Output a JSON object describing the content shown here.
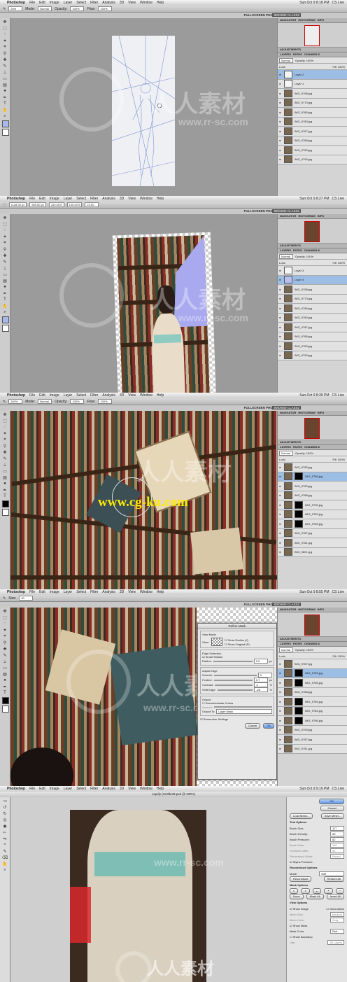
{
  "menu": {
    "app": "Photoshop",
    "items": [
      "File",
      "Edit",
      "Image",
      "Layer",
      "Select",
      "Filter",
      "Analysis",
      "3D",
      "View",
      "Window",
      "Help"
    ],
    "frames": [
      {
        "time": "Sun Oct 9  8:18 PM",
        "user": "CS Live"
      },
      {
        "time": "Sun Oct 9  8:27 PM",
        "user": "CS Live"
      },
      {
        "time": "Sun Oct 9  8:39 PM",
        "user": "CS Live"
      },
      {
        "time": "Sun Oct 9  8:55 PM",
        "user": "CS Live"
      },
      {
        "time": "Sun Oct 9  9:19 PM",
        "user": "CS Live"
      }
    ]
  },
  "options": {
    "mode_label": "Mode:",
    "mode_value": "Normal",
    "opacity_label": "Opacity:",
    "opacity_value": "100%",
    "flow_label": "Flow:",
    "flow_value": "100%",
    "zoom1": "25%",
    "zoom3": "100%",
    "transform_x": "1128.00 px",
    "transform_y": "969.50 px",
    "transform_w": "100.00%",
    "transform_h": "100.00%",
    "transform_angle": "22.00",
    "size_label": "Size:",
    "size_value": "30"
  },
  "workspace": {
    "name": "FULLSCREEN PHOTO",
    "doc": "800X600 CLASS2"
  },
  "panels": {
    "tabs": [
      "NAVIGATOR",
      "HISTOGRAM",
      "INFO"
    ],
    "adjustments": "ADJUSTMENTS",
    "layer_tabs": [
      "LAYERS",
      "PATHS",
      "CHANNELS"
    ],
    "blend": "Normal",
    "opacity": "Opacity: 100%",
    "lock": "Lock:",
    "fill": "Fill: 100%"
  },
  "layers_frame1": [
    "Layer 2",
    "Layer 1",
    "IMG_9798.jpg",
    "IMG_9773.jpg",
    "IMG_9785.jpg",
    "IMG_9783.jpg",
    "IMG_9787.jpg",
    "IMG_9788.jpg",
    "IMG_9789.jpg",
    "IMG_9790.jpg"
  ],
  "layers_frame2": [
    "Layer 3",
    "Layer 4",
    "IMG_9798.jpg",
    "IMG_9773.jpg",
    "IMG_9785.jpg",
    "IMG_9783.jpg",
    "IMG_9787.jpg",
    "IMG_9788.jpg",
    "IMG_9789.jpg",
    "IMG_9790.jpg"
  ],
  "layers_frame3": [
    "IMG_9785.jpg",
    "IMG_9786.jpg",
    "IMG_9783.jpg",
    "IMG_9788.jpg",
    "IMG_9790.jpg",
    "IMG_9782.jpg",
    "IMG_9789.jpg",
    "IMG_9787.jpg",
    "IMG_9781.jpg",
    "IMG_9801.jpg"
  ],
  "layers_frame4": [
    "IMG_9787.jpg",
    "IMG_9783.jpg",
    "IMG_9785.jpg",
    "IMG_9788.jpg",
    "IMG_9789.jpg",
    "IMG_9782.jpg",
    "IMG_9786.jpg",
    "IMG_9790.jpg",
    "IMG_9787.jpg",
    "IMG_9781.jpg"
  ],
  "refine_mask": {
    "title": "Refine Mask",
    "view_mode": "View Mode",
    "view_label": "View:",
    "show_radius": "Show Radius (J)",
    "show_original": "Show Original (P)",
    "edge_detection": "Edge Detection",
    "smart_radius": "Smart Radius",
    "radius_label": "Radius:",
    "radius_value": "0.0",
    "radius_unit": "px",
    "adjust_edge": "Adjust Edge",
    "smooth_label": "Smooth:",
    "smooth_value": "0",
    "feather_label": "Feather:",
    "feather_value": "0.7",
    "feather_unit": "px",
    "contrast_label": "Contrast:",
    "contrast_value": "0",
    "contrast_unit": "%",
    "shift_label": "Shift Edge:",
    "shift_value": "-25",
    "shift_unit": "%",
    "output": "Output",
    "decontaminate": "Decontaminate Colors",
    "amount_label": "Amount:",
    "output_to_label": "Output To:",
    "output_to_value": "Layer Mask",
    "remember": "Remember Settings",
    "cancel": "Cancel",
    "ok": "OK"
  },
  "liquify": {
    "title": "Liquify (Untitled3.psd @ 100%)",
    "ok": "OK",
    "cancel": "Cancel",
    "load_mesh": "Load Mesh...",
    "save_mesh": "Save Mesh...",
    "tool_options": "Tool Options",
    "rows": [
      {
        "label": "Brush Size:",
        "value": "117"
      },
      {
        "label": "Brush Density:",
        "value": "50"
      },
      {
        "label": "Brush Pressure:",
        "value": "82"
      },
      {
        "label": "Brush Rate:",
        "value": "100"
      },
      {
        "label": "Turbulent Jitter:",
        "value": "50"
      }
    ],
    "reconstruct_mode_label": "Reconstruct Mode:",
    "reconstruct_mode_value": "Revert",
    "stylus": "Stylus Pressure",
    "recon_options": "Reconstruct Options",
    "mode_label": "Mode:",
    "mode_value": "Stiff",
    "reconstruct": "Reconstruct",
    "restore_all": "Restore All",
    "mask_options": "Mask Options",
    "none": "None",
    "mask_all": "Mask All",
    "invert_all": "Invert All",
    "view_options": "View Options",
    "show_image": "Show Image",
    "show_mesh": "Show Mesh",
    "mesh_size_label": "Mesh Size:",
    "mesh_size_value": "Medium",
    "mesh_color_label": "Mesh Color:",
    "mesh_color_value": "Gray",
    "show_mask": "Show Mask",
    "mask_color_label": "Mask Color:",
    "mask_color_value": "Red",
    "show_backdrop": "Show Backdrop",
    "use_label": "Use:",
    "use_value": "All Layers"
  },
  "watermarks": {
    "cn": "人人素材",
    "url": "www.rr-sc.com",
    "cgku": "www.cg-ku.com"
  },
  "colors": {
    "accent": "#5e95e4",
    "selection": "#9cbde4",
    "mask_red": "#d9282b"
  }
}
